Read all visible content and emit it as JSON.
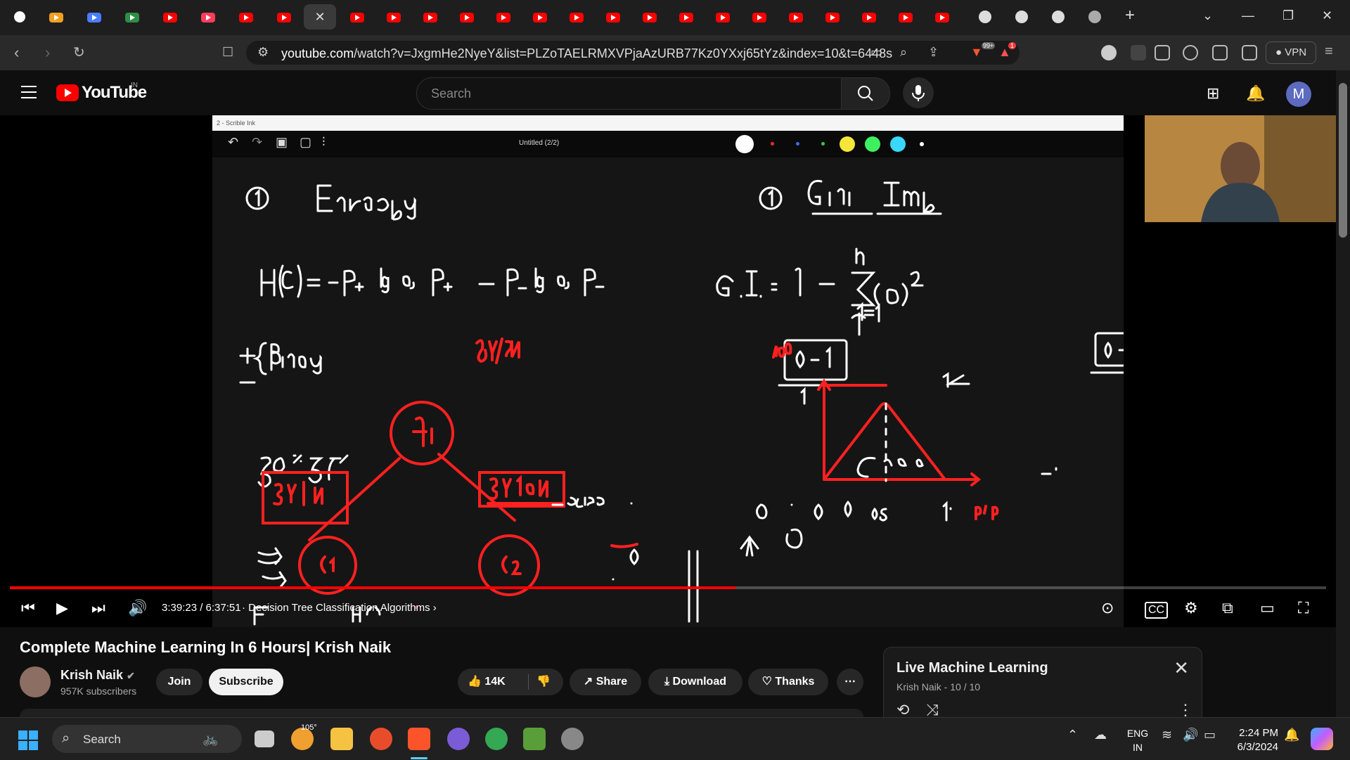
{
  "browser": {
    "url_domain": "youtube.com",
    "url_path": "/watch?v=JxgmHe2NyeY&list=PLZoTAELRMXVPjaAzURB77Kz0YXxj65tYz&index=10&t=6448s",
    "vpn_label": "VPN",
    "badge_count": "99+",
    "alert_count": "1"
  },
  "youtube": {
    "logo_text": "YouTube",
    "region": "IN",
    "search_placeholder": "Search",
    "avatar_letter": "M"
  },
  "whiteboard": {
    "app_title": "2 - Scrible Ink",
    "doc_title": "Untitled (2/2)",
    "pen_colors": [
      "#ff2a2a",
      "#3b6cff",
      "#35c94a",
      "#f5e63a",
      "#3ef060",
      "#3ad8ff",
      "#ffffff"
    ]
  },
  "player": {
    "time": "3:39:23 / 6:37:51",
    "chapter": "Decision Tree Classification Algorithms",
    "progress": 0.5515,
    "accent": "#ff0000"
  },
  "video": {
    "title": "Complete Machine Learning In 6 Hours| Krish Naik",
    "channel": "Krish Naik",
    "subscribers": "957K subscribers",
    "join_label": "Join",
    "subscribe_label": "Subscribe",
    "likes": "14K",
    "share_label": "Share",
    "download_label": "Download",
    "thanks_label": "Thanks"
  },
  "playlist": {
    "title": "Live Machine Learning",
    "subtitle": "Krish Naik - 10 / 10"
  },
  "taskbar": {
    "search_label": "Search",
    "weather": "105°",
    "lang_line1": "ENG",
    "lang_line2": "IN",
    "time": "2:24 PM",
    "date": "6/3/2024"
  }
}
